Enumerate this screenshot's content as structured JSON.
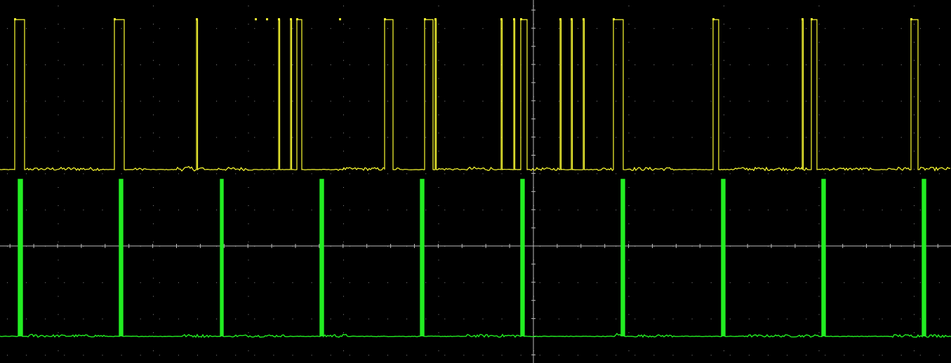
{
  "chart_data": {
    "type": "line",
    "title": "",
    "xlabel": "",
    "ylabel": "",
    "grid": true,
    "x_divisions": 10,
    "y_divisions": 8,
    "colors": {
      "background": "#000000",
      "grid_dots": "#8a8a8a",
      "axis": "#bdbdbd",
      "channel_1": "#ffff33",
      "channel_2": "#22ee22"
    },
    "series": [
      {
        "channel": 1,
        "level_low": 0.0,
        "level_high": 1.0,
        "wide_pulses": [
          {
            "start": 0.21,
            "end": 0.35
          },
          {
            "start": 1.63,
            "end": 1.77
          },
          {
            "start": 4.23,
            "end": 4.3
          },
          {
            "start": 5.48,
            "end": 5.6
          },
          {
            "start": 6.05,
            "end": 6.17
          },
          {
            "start": 7.42,
            "end": 7.51
          },
          {
            "start": 8.74,
            "end": 8.88
          },
          {
            "start": 10.16,
            "end": 10.24
          },
          {
            "start": 11.56,
            "end": 11.64
          },
          {
            "start": 12.98,
            "end": 13.08
          }
        ],
        "narrow_pulses": [
          2.8,
          3.64,
          3.8,
          3.97,
          4.14,
          4.84,
          6.2,
          7.14,
          7.32,
          7.98,
          8.14,
          8.31,
          11.43
        ],
        "noise_segments": [
          {
            "start": 0.35,
            "end": 0.75,
            "amp": 0.018
          },
          {
            "start": 0.75,
            "end": 1.48,
            "amp": 0.022
          },
          {
            "start": 1.9,
            "end": 2.1,
            "amp": 0.015
          },
          {
            "start": 2.52,
            "end": 2.9,
            "amp": 0.03
          },
          {
            "start": 3.1,
            "end": 3.6,
            "amp": 0.022
          },
          {
            "start": 4.8,
            "end": 5.68,
            "amp": 0.02
          },
          {
            "start": 6.25,
            "end": 6.55,
            "amp": 0.015
          },
          {
            "start": 6.65,
            "end": 7.05,
            "amp": 0.025
          },
          {
            "start": 7.55,
            "end": 7.95,
            "amp": 0.018
          },
          {
            "start": 8.5,
            "end": 8.73,
            "amp": 0.02
          },
          {
            "start": 8.93,
            "end": 9.6,
            "amp": 0.022
          },
          {
            "start": 10.4,
            "end": 11.5,
            "amp": 0.022
          },
          {
            "start": 11.7,
            "end": 12.4,
            "amp": 0.018
          },
          {
            "start": 12.65,
            "end": 12.95,
            "amp": 0.025
          },
          {
            "start": 13.12,
            "end": 13.55,
            "amp": 0.022
          }
        ]
      },
      {
        "channel": 2,
        "level_low": 0.0,
        "level_high": 1.0,
        "pulses": [
          {
            "start": 0.26,
            "end": 0.32
          },
          {
            "start": 1.7,
            "end": 1.75
          },
          {
            "start": 3.14,
            "end": 3.18
          },
          {
            "start": 4.56,
            "end": 4.61
          },
          {
            "start": 5.99,
            "end": 6.04
          },
          {
            "start": 7.42,
            "end": 7.47
          },
          {
            "start": 8.85,
            "end": 8.9
          },
          {
            "start": 10.28,
            "end": 10.33
          },
          {
            "start": 11.71,
            "end": 11.76
          },
          {
            "start": 13.14,
            "end": 13.19
          }
        ],
        "noise_segments": [
          {
            "start": 0.4,
            "end": 0.7,
            "amp": 0.02
          },
          {
            "start": 0.75,
            "end": 1.5,
            "amp": 0.015
          },
          {
            "start": 2.55,
            "end": 3.0,
            "amp": 0.018
          },
          {
            "start": 3.3,
            "end": 4.05,
            "amp": 0.015
          },
          {
            "start": 4.62,
            "end": 4.95,
            "amp": 0.02
          },
          {
            "start": 6.65,
            "end": 7.4,
            "amp": 0.018
          },
          {
            "start": 8.75,
            "end": 8.9,
            "amp": 0.03
          },
          {
            "start": 9.0,
            "end": 9.6,
            "amp": 0.015
          },
          {
            "start": 10.55,
            "end": 11.65,
            "amp": 0.015
          },
          {
            "start": 12.7,
            "end": 13.5,
            "amp": 0.018
          }
        ]
      }
    ]
  }
}
